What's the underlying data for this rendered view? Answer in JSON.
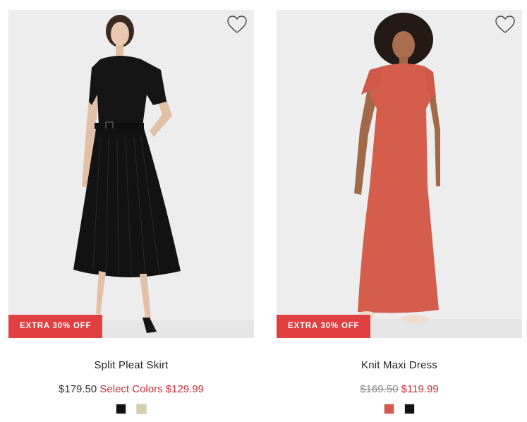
{
  "products": [
    {
      "name": "Split Pleat Skirt",
      "badge": "EXTRA 30% OFF",
      "price_regular": "$179.50",
      "price_sale_label": "Select Colors",
      "price_sale": "$129.99",
      "swatches": [
        "#111111",
        "#d8d0a8"
      ]
    },
    {
      "name": "Knit Maxi Dress",
      "badge": "EXTRA 30% OFF",
      "price_original": "$169.50",
      "price_sale": "$119.99",
      "swatches": [
        "#d9574a",
        "#111111"
      ]
    }
  ]
}
